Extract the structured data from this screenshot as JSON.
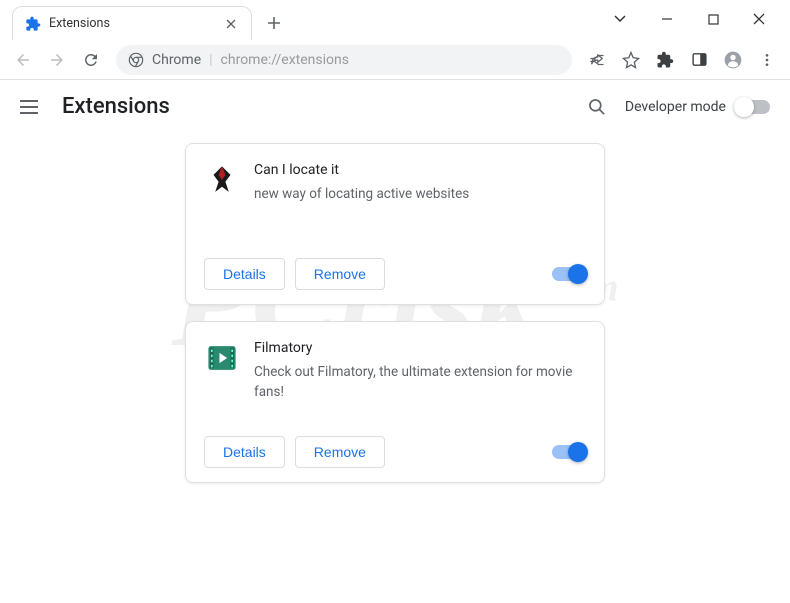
{
  "window": {
    "tab_title": "Extensions"
  },
  "address": {
    "label": "Chrome",
    "url": "chrome://extensions"
  },
  "page": {
    "title": "Extensions",
    "dev_mode_label": "Developer mode"
  },
  "buttons": {
    "details": "Details",
    "remove": "Remove"
  },
  "extensions": [
    {
      "name": "Can I locate it",
      "description": "new way of locating active websites",
      "enabled": true,
      "icon": "bird"
    },
    {
      "name": "Filmatory",
      "description": "Check out Filmatory, the ultimate extension for movie fans!",
      "enabled": true,
      "icon": "film"
    }
  ],
  "watermark": {
    "text": "PCrisk",
    "suffix": ".com"
  }
}
